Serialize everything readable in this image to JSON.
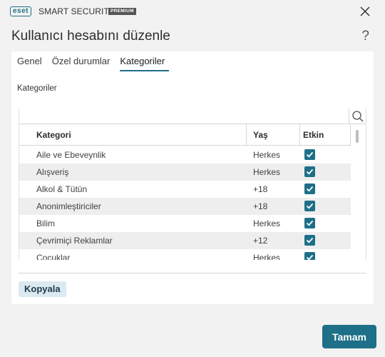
{
  "titlebar": {
    "logo_text": "eset",
    "product": "SMART SECURITY",
    "edition": "PREMIUM",
    "close_icon": "close-icon"
  },
  "dialog": {
    "title": "Kullanıcı hesabını düzenle",
    "help_label": "?"
  },
  "tabs": [
    {
      "label": "Genel",
      "active": false
    },
    {
      "label": "Özel durumlar",
      "active": false
    },
    {
      "label": "Kategoriler",
      "active": true
    }
  ],
  "section_label": "Kategoriler",
  "table": {
    "search_icon": "search-icon",
    "columns": [
      "Kategori",
      "Yaş",
      "Etkin"
    ],
    "rows": [
      {
        "category": "Aile ve Ebeveynlik",
        "age": "Herkes",
        "enabled": true
      },
      {
        "category": "Alışveriş",
        "age": "Herkes",
        "enabled": true
      },
      {
        "category": "Alkol & Tütün",
        "age": "+18",
        "enabled": true
      },
      {
        "category": "Anonimleştiriciler",
        "age": "+18",
        "enabled": true
      },
      {
        "category": "Bilim",
        "age": "Herkes",
        "enabled": true
      },
      {
        "category": "Çevrimiçi Reklamlar",
        "age": "+12",
        "enabled": true
      },
      {
        "category": "Çocuklar",
        "age": "Herkes",
        "enabled": true
      }
    ]
  },
  "buttons": {
    "copy": "Kopyala",
    "ok": "Tamam"
  },
  "colors": {
    "accent": "#1e6f88",
    "copy_bg": "#dbe9f1",
    "panel_bg": "#ffffff",
    "window_bg": "#f2f2f2",
    "alt_row": "#eeeeee"
  }
}
